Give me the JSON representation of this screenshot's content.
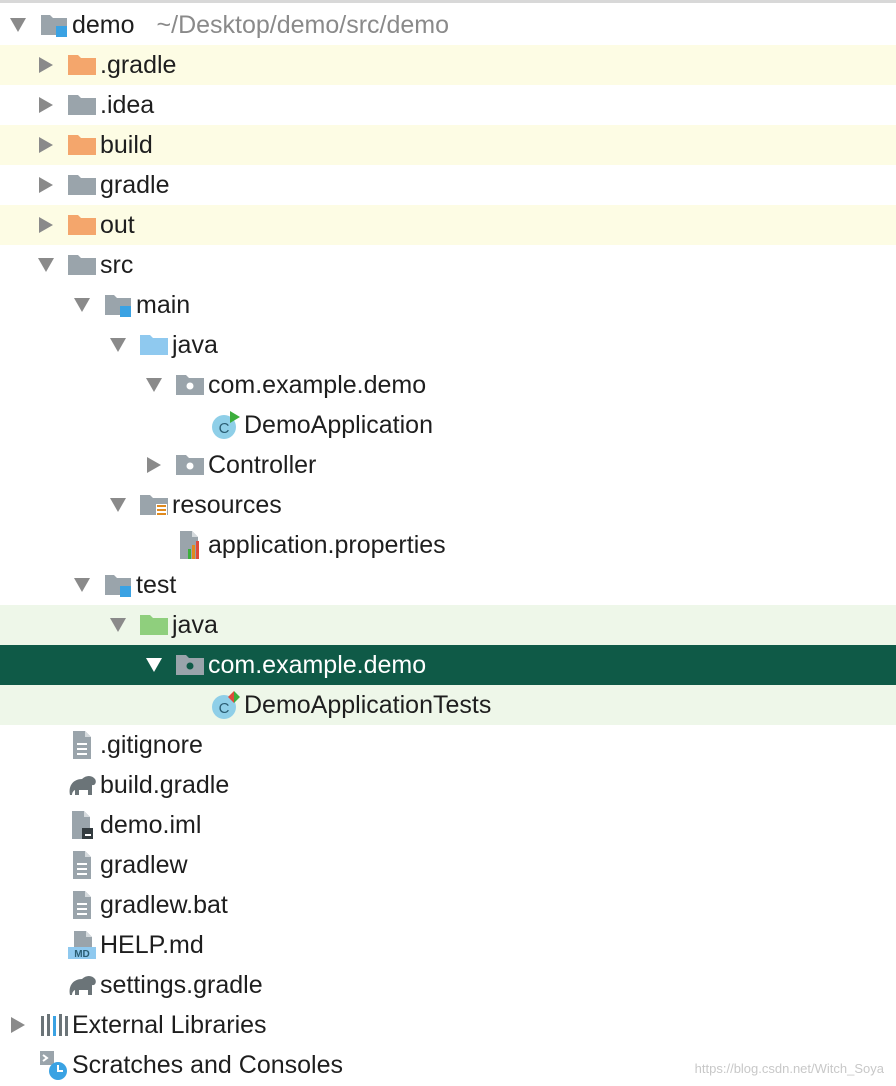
{
  "tree": {
    "root": {
      "label": "demo",
      "path": "~/Desktop/demo/src/demo"
    },
    "gradle_dir": "gradle",
    "dot_gradle": ".gradle",
    "idea": ".idea",
    "build": "build",
    "out": "out",
    "src": "src",
    "main": "main",
    "main_java": "java",
    "main_pkg": "com.example.demo",
    "demo_app": "DemoApplication",
    "controller": "Controller",
    "resources": "resources",
    "app_props": "application.properties",
    "test": "test",
    "test_java": "java",
    "test_pkg": "com.example.demo",
    "demo_tests": "DemoApplicationTests",
    "gitignore": ".gitignore",
    "build_gradle": "build.gradle",
    "demo_iml": "demo.iml",
    "gradlew": "gradlew",
    "gradlew_bat": "gradlew.bat",
    "help_md": "HELP.md",
    "settings_gradle": "settings.gradle",
    "external_libraries": "External Libraries",
    "scratches": "Scratches and Consoles"
  },
  "icons": {
    "md_badge": "MD",
    "class_letter": "C"
  },
  "watermark": "https://blog.csdn.net/Witch_Soya",
  "colors": {
    "selected_row": "#0f5a47",
    "ignored_row": "#fdfce4",
    "test_row": "#eef7e9",
    "excluded_folder": "#f4a66c",
    "source_folder": "#8fc9ef",
    "test_folder": "#8fcf7d",
    "module_badge": "#3aa2e3"
  }
}
